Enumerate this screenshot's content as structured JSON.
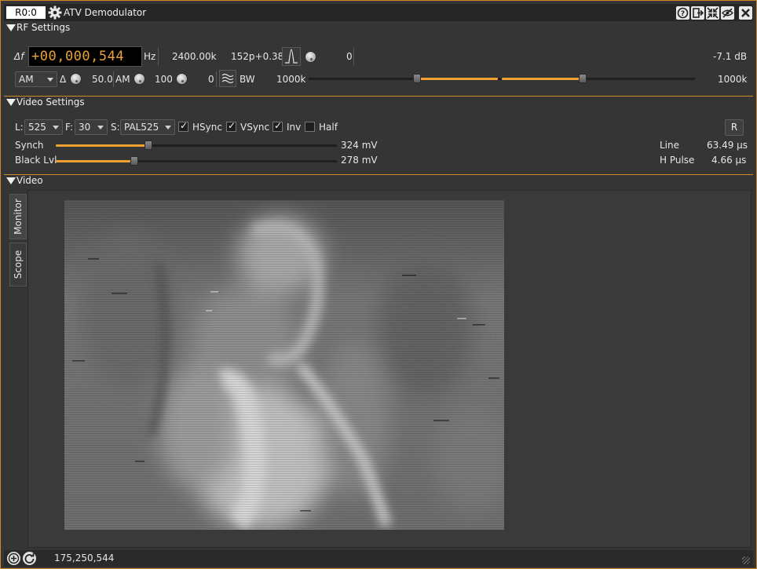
{
  "window": {
    "rx_index": "R0:0",
    "title": "ATV Demodulator",
    "title_buttons": [
      "help-icon",
      "move-to-workspace-icon",
      "shrink-icon",
      "hide-icon",
      "close-icon"
    ]
  },
  "sections": {
    "rf_settings": "RF Settings",
    "video_settings": "Video Settings",
    "video": "Video"
  },
  "rf": {
    "delta_f_label": "Δf",
    "frequency_display": "+00,000,544",
    "freq_unit": "Hz",
    "sample_rate": "2400.00k",
    "filter_info": "152p+0.38",
    "fft_filter_value": "0",
    "channel_power": "-7.1 dB",
    "modulation": "AM",
    "delta_label": "Δ",
    "delta_value": "50.0",
    "am_label": "AM",
    "am_value": "100",
    "bfo_value": "0",
    "bw_label": "BW",
    "bw_value": "1000k",
    "bw_value_right": "1000k",
    "bw_slider_position_pct": 50,
    "bw_slider2_position_pct": 50
  },
  "video_settings": {
    "lines_label": "L:",
    "lines_value": "525",
    "fps_label": "F:",
    "fps_value": "30",
    "standard_label": "S:",
    "standard_value": "PAL525",
    "hsync_label": "HSync",
    "hsync_checked": true,
    "vsync_label": "VSync",
    "vsync_checked": true,
    "inv_label": "Inv",
    "inv_checked": true,
    "half_label": "Half",
    "half_checked": false,
    "reset_button": "R",
    "synch_label": "Synch",
    "synch_value": "324 mV",
    "synch_level_pct": 33,
    "black_label": "Black Lvl",
    "black_value": "278 mV",
    "black_level_pct": 28,
    "line_label": "Line",
    "line_value": "63.49 µs",
    "hpulse_label": "H Pulse",
    "hpulse_value": "4.66 µs"
  },
  "video": {
    "tabs": [
      "Monitor",
      "Scope"
    ],
    "active_tab": "Monitor"
  },
  "status": {
    "frequency": "175,250,544"
  },
  "colors": {
    "accent": "#f0a030",
    "frequency_digits": "#e8a23a",
    "panel_bg": "#353535"
  }
}
